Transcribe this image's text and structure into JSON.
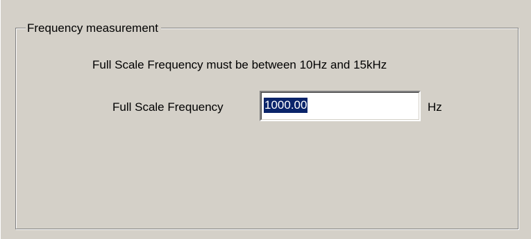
{
  "group": {
    "title": "Frequency measurement"
  },
  "instruction": "Full Scale Frequency must be between 10Hz and 15kHz",
  "full_scale_frequency": {
    "label": "Full Scale Frequency",
    "value": "1000.00",
    "unit": "Hz",
    "selected": true
  },
  "colors": {
    "background": "#d4d0c8",
    "selection": "#0a246a",
    "input_background": "#ffffff"
  }
}
